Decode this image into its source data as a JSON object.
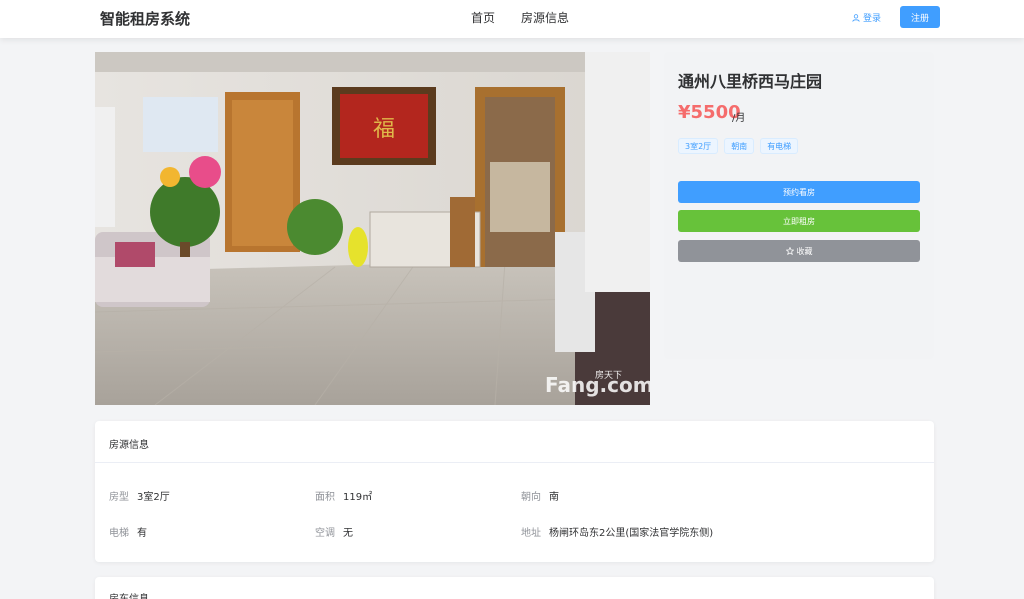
{
  "header": {
    "brand": "智能租房系统",
    "nav": [
      {
        "label": "首页"
      },
      {
        "label": "房源信息"
      }
    ],
    "login_label": "登录",
    "register_label": "注册"
  },
  "photo": {
    "watermark_top": "房天下",
    "watermark": "Fang.com",
    "plaque": "福"
  },
  "house": {
    "title": "通州八里桥西马庄园",
    "price": "¥5500",
    "price_unit": "/月",
    "tags": [
      "3室2厅",
      "朝南",
      "有电梯"
    ],
    "btn_book": "预约看房",
    "btn_rent": "立即租房",
    "btn_fav": "收藏"
  },
  "details": {
    "title": "房源信息",
    "fields": [
      {
        "key": "房型",
        "value": "3室2厅"
      },
      {
        "key": "面积",
        "value": "119㎡"
      },
      {
        "key": "朝向",
        "value": "南"
      },
      {
        "key": "电梯",
        "value": "有"
      },
      {
        "key": "空调",
        "value": "无"
      },
      {
        "key": "地址",
        "value": "杨闸环岛东2公里(国家法官学院东侧)"
      }
    ]
  },
  "landlord": {
    "title": "房东信息"
  },
  "colors": {
    "primary": "#409eff",
    "success": "#67c23a",
    "info": "#909399",
    "price": "#f56c6c"
  },
  "icons": {
    "login": "user-icon",
    "favorite": "star-icon"
  }
}
